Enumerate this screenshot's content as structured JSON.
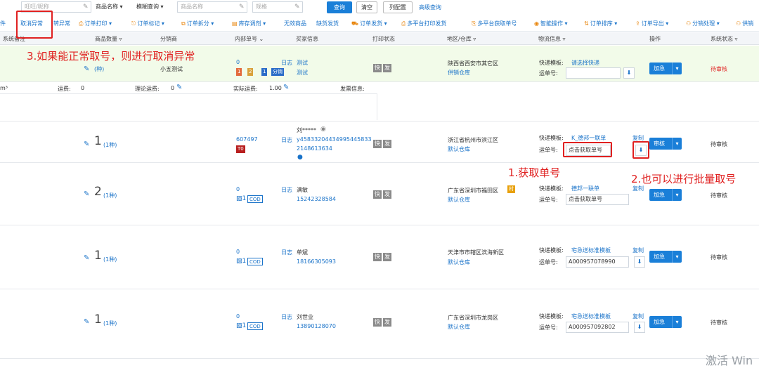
{
  "search_bar": {
    "wangwang_placeholder": "旺旺/昵称",
    "product_field_select": "商品名称",
    "match_mode_select": "模糊查询",
    "product_name_placeholder": "商品名称",
    "spec_placeholder": "规格",
    "query_button": "查询",
    "clear_button": "清空",
    "column_config_button": "列配置",
    "advanced_search_link": "高级查询"
  },
  "toolbar": {
    "items": [
      {
        "label": "件"
      },
      {
        "label": "取消异常"
      },
      {
        "label": "转异常"
      },
      {
        "label": "订单打印"
      },
      {
        "label": "订单标记"
      },
      {
        "label": "订单拆分"
      },
      {
        "label": "库存调剂"
      },
      {
        "label": "无效商品"
      },
      {
        "label": "缺货发货"
      },
      {
        "label": "订单发货"
      },
      {
        "label": "多平台打印发货"
      },
      {
        "label": "多平台获取单号"
      },
      {
        "label": "智能操作"
      },
      {
        "label": "订单排序"
      },
      {
        "label": "订单导出"
      },
      {
        "label": "分销处理"
      },
      {
        "label": "供销"
      }
    ]
  },
  "table": {
    "headers": {
      "system_note": "系统备注",
      "product_qty": "商品数量",
      "distributor": "分销商",
      "internal_no": "内部单号",
      "buyer_info": "买家信息",
      "print_status": "打印状态",
      "region_warehouse": "地区/仓库",
      "logistics_info": "物流信息",
      "operation": "操作",
      "system_status": "系统状态"
    },
    "rows": [
      {
        "qty": "",
        "kinds": "(种)",
        "distributor": "小五测试",
        "internal_no": "0",
        "log": "日志",
        "buyer_name": "测试",
        "buyer_phone": "测试",
        "tags": [
          "1",
          "2",
          "1",
          "分销"
        ],
        "print_a": "快",
        "print_b": "发",
        "region": "陕西省西安市其它区",
        "warehouse": "供销仓库",
        "tpl_label": "快递模板:",
        "tpl_value": "请选择快递",
        "waybill_label": "运单号:",
        "waybill_value": "",
        "copy": "",
        "action": "加急",
        "status": "待审核"
      },
      {
        "qty": "1",
        "kinds": "(1种)",
        "distributor": "",
        "internal_no": "607497",
        "log": "日志",
        "buyer_name": "刘*****",
        "buyer_phone": "y45833204434995445833",
        "buyer_phone2": "2148613634",
        "tags": [
          "T0"
        ],
        "print_a": "快",
        "print_b": "发",
        "region": "浙江省杭州市滨江区",
        "warehouse": "默认仓库",
        "tpl_label": "快递模板:",
        "tpl_value": "K_德邦一联单",
        "waybill_label": "运单号:",
        "waybill_value": "点击获取单号",
        "copy": "复制",
        "action": "审核",
        "status": "待审核"
      },
      {
        "qty": "2",
        "kinds": "(1种)",
        "distributor": "",
        "internal_no": "0",
        "log": "日志",
        "buyer_name": "满敏",
        "buyer_phone": "15242328584",
        "tags": [
          "COD"
        ],
        "print_a": "快",
        "print_b": "发",
        "region": "广东省深圳市福田区",
        "region_badge": "村",
        "warehouse": "默认仓库",
        "tpl_label": "快递模板:",
        "tpl_value": "德邦一联单",
        "waybill_label": "运单号:",
        "waybill_value": "点击获取单号",
        "copy": "复制",
        "action": "加急",
        "status": "待审核"
      },
      {
        "qty": "1",
        "kinds": "(1种)",
        "distributor": "",
        "internal_no": "0",
        "log": "日志",
        "buyer_name": "单斌",
        "buyer_phone": "18166305093",
        "tags": [
          "COD"
        ],
        "print_a": "快",
        "print_b": "发",
        "region": "天津市市辖区滨海新区",
        "warehouse": "默认仓库",
        "tpl_label": "快递模板:",
        "tpl_value": "宅急送标准模板",
        "waybill_label": "运单号:",
        "waybill_value": "A000957078990",
        "copy": "复制",
        "action": "加急",
        "status": "待审核"
      },
      {
        "qty": "1",
        "kinds": "(1种)",
        "distributor": "",
        "internal_no": "0",
        "log": "日志",
        "buyer_name": "刘世业",
        "buyer_phone": "13890128070",
        "tags": [
          "COD"
        ],
        "print_a": "快",
        "print_b": "发",
        "region": "广东省深圳市龙岗区",
        "warehouse": "默认仓库",
        "tpl_label": "快递模板:",
        "tpl_value": "宅急送标准模板",
        "waybill_label": "运单号:",
        "waybill_value": "A000957092802",
        "copy": "复制",
        "action": "加急",
        "status": "待审核"
      }
    ],
    "detail": {
      "unit": "m³",
      "freight_label": "运费:",
      "freight_value": "0",
      "theory_freight_label": "理论运费:",
      "theory_freight_value": "0",
      "actual_freight_label": "实际运费:",
      "actual_freight_value": "1.00",
      "shipping_info_label": "发票信息:"
    }
  },
  "annotations": {
    "step1": "1.获取单号",
    "step2": "2.也可以进行批量取号",
    "step3": "3.如果能正常取号，则进行取消异常"
  },
  "watermark": "激活 Win",
  "colors": {
    "accent": "#1a7fd8",
    "annotation": "#e02020",
    "highlight_row": "#f2fbe9"
  }
}
